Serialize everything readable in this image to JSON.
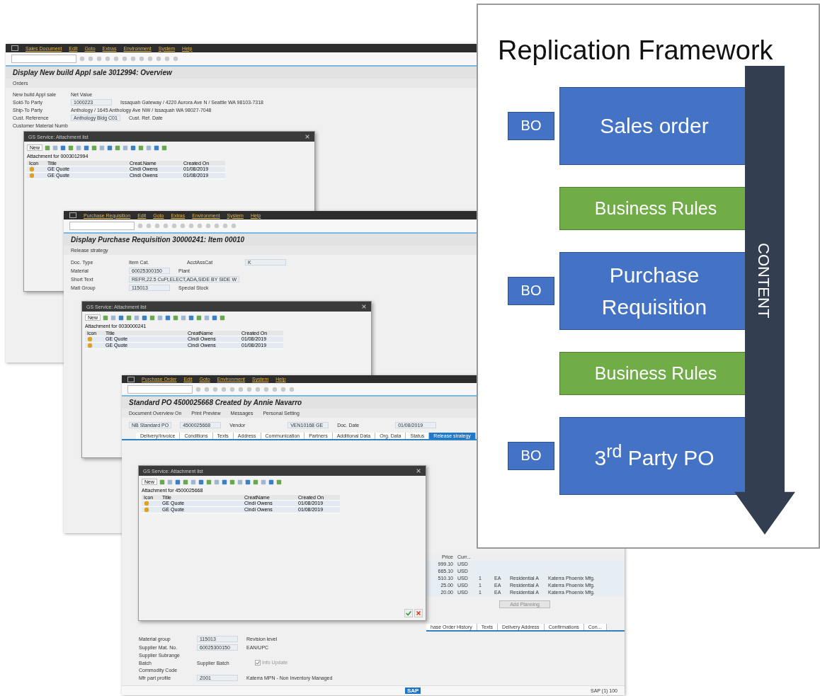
{
  "windows": [
    {
      "menu": [
        "Sales Document",
        "Edit",
        "Goto",
        "Extras",
        "Environment",
        "System",
        "Help"
      ],
      "title": "Display New build Appl sale 3012994: Overview",
      "toolbar": [
        "Orders"
      ],
      "fields": [
        [
          {
            "kind": "label",
            "text": "New build Appl sale"
          },
          {
            "kind": "label",
            "text": "Net Value"
          }
        ],
        [
          {
            "kind": "label",
            "text": "Sold-To Party"
          },
          {
            "kind": "value",
            "text": "1000223"
          },
          {
            "kind": "text",
            "text": "Issaquah Gateway / 4220 Aurora Ave N / Seattle WA 98103-7318"
          }
        ],
        [
          {
            "kind": "label",
            "text": "Ship-To Party"
          },
          {
            "kind": "text",
            "text": "Anthology / 1645 Anthology Ave NW / Issaquah WA 98027-7048"
          }
        ],
        [
          {
            "kind": "label",
            "text": "Cust. Reference"
          },
          {
            "kind": "value",
            "text": "Anthology Bldg C01"
          },
          {
            "kind": "label",
            "text": "Cust. Ref. Date"
          }
        ],
        [
          {
            "kind": "label",
            "text": "Customer Material Numb"
          }
        ]
      ],
      "dialog": {
        "title": "GS Service: Attachment list",
        "new": "New",
        "caption": "Attachment for 0003012994",
        "columns": [
          "Icon",
          "Title",
          "Creat.Name",
          "Created On"
        ],
        "rows": [
          [
            "",
            "GE Quote",
            "Cindi Owens",
            "01/08/2019"
          ],
          [
            "",
            "GE Quote",
            "Cindi Owens",
            "01/08/2019"
          ]
        ]
      }
    },
    {
      "menu": [
        "Purchase Requisition",
        "Edit",
        "Goto",
        "Extras",
        "Environment",
        "System",
        "Help"
      ],
      "title": "Display Purchase Requisition 30000241: Item 00010",
      "toolbar": [
        "Release strategy"
      ],
      "fields": [
        [
          {
            "kind": "label",
            "text": "Doc. Type"
          },
          {
            "kind": "label",
            "text": "Item Cat."
          },
          {
            "kind": "label",
            "text": "AcctAssCat"
          },
          {
            "kind": "value",
            "text": "K"
          }
        ],
        [
          {
            "kind": "label",
            "text": "Material"
          },
          {
            "kind": "value",
            "text": "60025300150"
          },
          {
            "kind": "label",
            "text": "Plant"
          }
        ],
        [
          {
            "kind": "label",
            "text": "Short Text"
          },
          {
            "kind": "value",
            "text": "REFR,22.5 CuFt,ELECT,ADA,SIDE BY SIDE W"
          }
        ],
        [
          {
            "kind": "label",
            "text": "Matl Group"
          },
          {
            "kind": "value",
            "text": "115013"
          },
          {
            "kind": "label",
            "text": "Special Stock"
          }
        ]
      ],
      "dialog": {
        "title": "GS Service: Attachment list",
        "new": "New",
        "caption": "Attachment for 0030000241",
        "columns": [
          "Icon",
          "Title",
          "CreatName",
          "Created On"
        ],
        "rows": [
          [
            "",
            "GE Quote",
            "Cindi Owens",
            "01/08/2019"
          ],
          [
            "",
            "GE Quote",
            "Cindi Owens",
            "01/08/2019"
          ]
        ]
      }
    },
    {
      "menu": [
        "Purchase Order",
        "Edit",
        "Goto",
        "Environment",
        "System",
        "Help"
      ],
      "title": "Standard PO 4500025668 Created by Annie Navarro",
      "toolbar": [
        "Document Overview On",
        "Print Preview",
        "Messages",
        "Personal Setting"
      ],
      "fields": [
        [
          {
            "kind": "value",
            "text": "NB Standard PO"
          },
          {
            "kind": "value",
            "text": "4500025668"
          },
          {
            "kind": "label",
            "text": "Vendor"
          },
          {
            "kind": "value",
            "text": "VEN10168 GE"
          },
          {
            "kind": "label",
            "text": "Doc. Date"
          },
          {
            "kind": "value",
            "text": "01/08/2019"
          }
        ]
      ],
      "tabs": [
        {
          "label": "Delivery/Invoice",
          "selected": false
        },
        {
          "label": "Conditions",
          "selected": false
        },
        {
          "label": "Texts",
          "selected": false
        },
        {
          "label": "Address",
          "selected": false
        },
        {
          "label": "Communication",
          "selected": false
        },
        {
          "label": "Partners",
          "selected": false
        },
        {
          "label": "Additional Data",
          "selected": false
        },
        {
          "label": "Org. Data",
          "selected": false
        },
        {
          "label": "Status",
          "selected": false
        },
        {
          "label": "Release strategy",
          "selected": true
        }
      ],
      "items": {
        "columns": [
          "Price",
          "Curr..."
        ],
        "rows": [
          [
            "999.10",
            "USD",
            "",
            "",
            "",
            ""
          ],
          [
            "665.10",
            "USD",
            "",
            "",
            "",
            ""
          ],
          [
            "510.10",
            "USD",
            "1",
            "EA",
            "Residential A",
            "Katerra Phoenix Mfg."
          ],
          [
            "25.00",
            "USD",
            "1",
            "EA",
            "Residential A",
            "Katerra Phoenix Mfg."
          ],
          [
            "20.00",
            "USD",
            "1",
            "EA",
            "Residential A",
            "Katerra Phoenix Mfg."
          ]
        ]
      },
      "button": "Add Planning",
      "lower_tabs": [
        {
          "label": "hase Order History",
          "selected": false
        },
        {
          "label": "Texts",
          "selected": false
        },
        {
          "label": "Delivery Address",
          "selected": false
        },
        {
          "label": "Confirmations",
          "selected": false
        },
        {
          "label": "Con...",
          "selected": false
        }
      ],
      "details": [
        [
          {
            "kind": "label",
            "text": "Material group"
          },
          {
            "kind": "value",
            "text": "115013"
          },
          {
            "kind": "label",
            "text": "Revision level"
          }
        ],
        [
          {
            "kind": "label",
            "text": "Supplier Mat. No."
          },
          {
            "kind": "value",
            "text": "60025300150"
          },
          {
            "kind": "label",
            "text": "EAN/UPC"
          }
        ],
        [
          {
            "kind": "label",
            "text": "Supplier Subrange"
          }
        ],
        [
          {
            "kind": "label",
            "text": "Batch"
          },
          {
            "kind": "label",
            "text": "Supplier Batch"
          },
          {
            "kind": "check",
            "text": "Info Update",
            "checked": true
          }
        ],
        [
          {
            "kind": "label",
            "text": "Commodity Code"
          }
        ],
        [
          {
            "kind": "label",
            "text": "Mfr part profile"
          },
          {
            "kind": "value",
            "text": "Z001"
          },
          {
            "kind": "text",
            "text": "Katerra MPN - Non Inventory Managed"
          }
        ]
      ],
      "status": {
        "logo": "SAP",
        "text": "SAP (1) 100"
      },
      "dialog": {
        "title": "GS Service: Attachment list",
        "new": "New",
        "caption": "Attachment for 4500025668",
        "columns": [
          "Icon",
          "Title",
          "CreatName",
          "Created On"
        ],
        "rows": [
          [
            "",
            "GE Quote",
            "Cindi Owens",
            "01/08/2019"
          ],
          [
            "",
            "GE Quote",
            "Cindi Owens",
            "01/08/2019"
          ]
        ]
      }
    }
  ],
  "framework": {
    "title": "Replication Framework",
    "arrow_label": "CONTENT",
    "steps": [
      {
        "kind": "bo",
        "tag": "BO",
        "label": "Sales order",
        "color": "#4472c4"
      },
      {
        "kind": "rules",
        "label": "Business Rules",
        "color": "#70ad47"
      },
      {
        "kind": "bo",
        "tag": "BO",
        "label": "Purchase Requisition",
        "color": "#4472c4"
      },
      {
        "kind": "rules",
        "label": "Business Rules",
        "color": "#70ad47"
      },
      {
        "kind": "bo",
        "tag": "BO",
        "label": "3$^{rd}$ Party PO",
        "color": "#4472c4"
      }
    ]
  }
}
